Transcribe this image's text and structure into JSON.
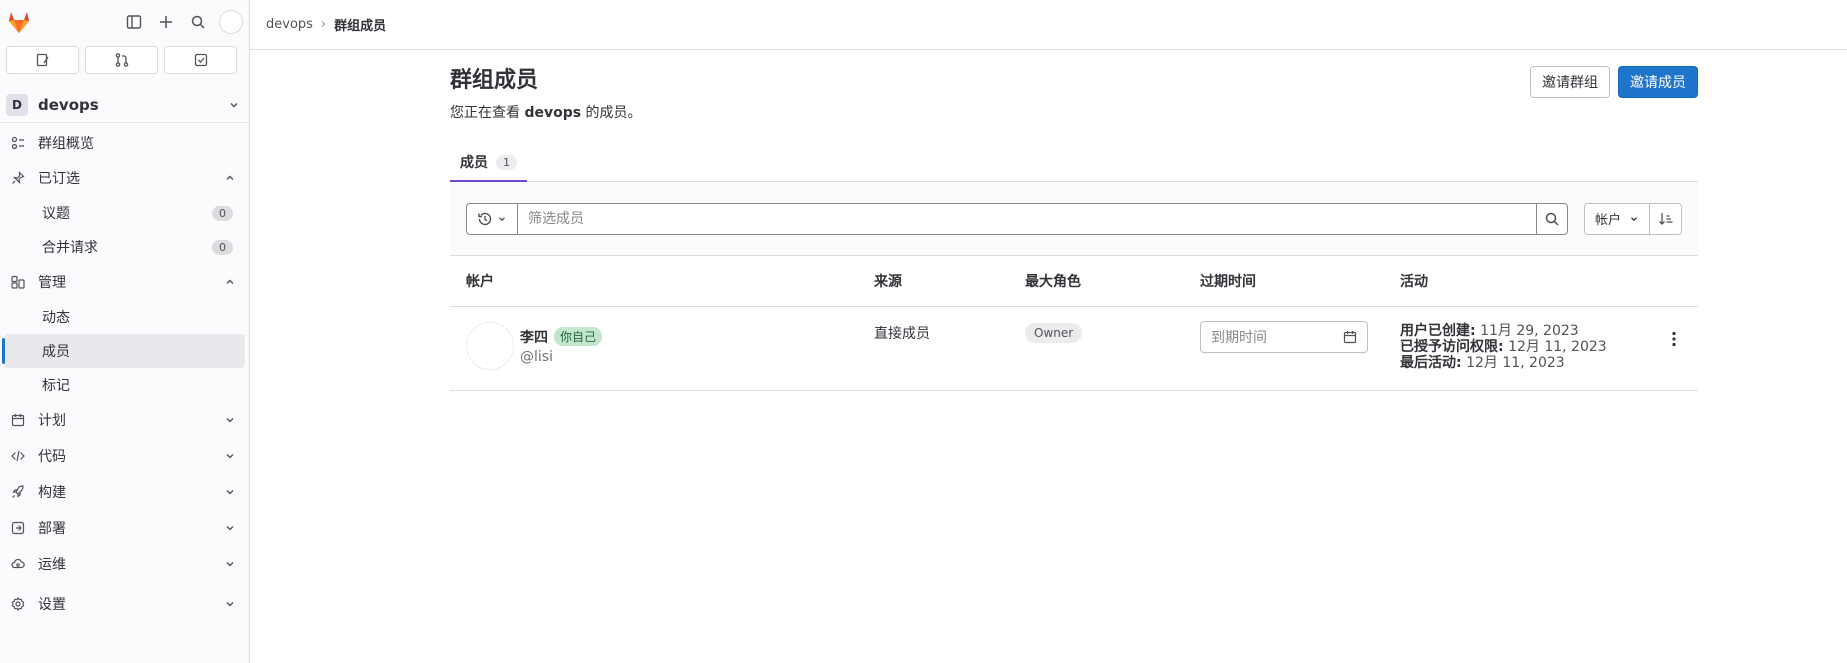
{
  "sidebar": {
    "context": {
      "avatar_letter": "D",
      "name": "devops"
    },
    "items": [
      {
        "label": "群组概览",
        "icon": "group-overview-icon"
      },
      {
        "label": "已订选",
        "icon": "pin-icon"
      },
      {
        "label": "议题",
        "count": "0"
      },
      {
        "label": "合并请求",
        "count": "0"
      },
      {
        "label": "管理",
        "icon": "users-icon"
      },
      {
        "label": "动态"
      },
      {
        "label": "成员"
      },
      {
        "label": "标记"
      },
      {
        "label": "计划",
        "icon": "calendar-icon"
      },
      {
        "label": "代码",
        "icon": "code-icon"
      },
      {
        "label": "构建",
        "icon": "rocket-icon"
      },
      {
        "label": "部署",
        "icon": "deployments-icon"
      },
      {
        "label": "运维",
        "icon": "cloud-icon"
      },
      {
        "label": "设置",
        "icon": "gear-icon"
      }
    ]
  },
  "breadcrumb": {
    "parent": "devops",
    "current": "群组成员"
  },
  "page": {
    "title": "群组成员",
    "subtitle_prefix": "您正在查看",
    "subtitle_group": "devops",
    "subtitle_suffix": "的成员。",
    "invite_group_label": "邀请群组",
    "invite_member_label": "邀请成员"
  },
  "tabs": [
    {
      "label": "成员",
      "count": "1"
    }
  ],
  "filter": {
    "placeholder": "筛选成员",
    "sort_label": "帐户"
  },
  "table": {
    "headers": [
      "帐户",
      "来源",
      "最大角色",
      "过期时间",
      "活动"
    ],
    "rows": [
      {
        "name": "李四",
        "you_badge": "你自己",
        "username": "@lisi",
        "source": "直接成员",
        "role": "Owner",
        "expire_placeholder": "到期时间",
        "created_label": "用户已创建:",
        "created_value": "11月 29, 2023",
        "granted_label": "已授予访问权限:",
        "granted_value": "12月 11, 2023",
        "last_label": "最后活动:",
        "last_value": "12月 11, 2023"
      }
    ]
  },
  "colors": {
    "primary": "#1f75cb",
    "tab_underline": "#6e49cb",
    "you_badge_bg": "#c3e6cd"
  }
}
